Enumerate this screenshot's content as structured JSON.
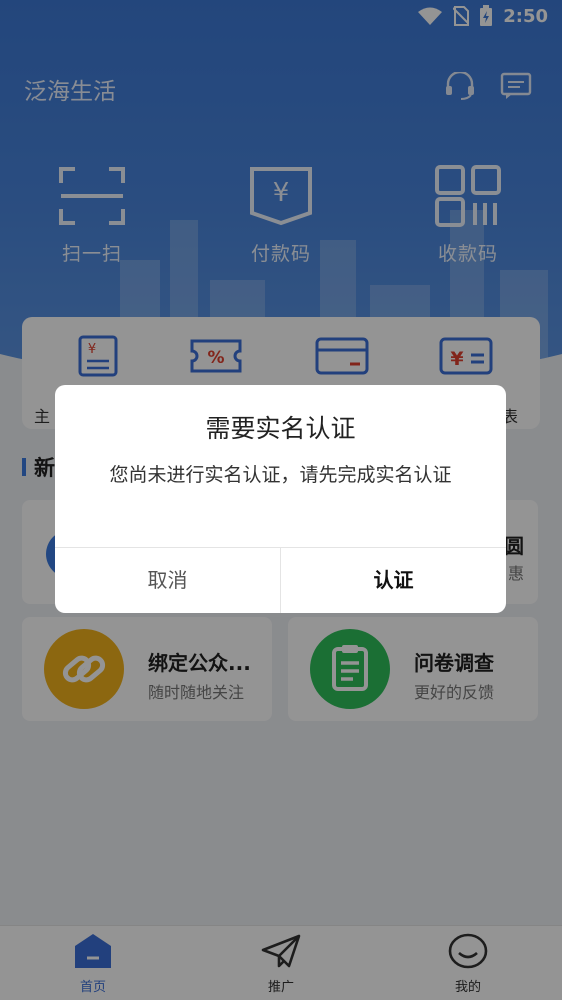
{
  "status_bar": {
    "time": "2:50"
  },
  "header": {
    "app_title": "泛海生活"
  },
  "quick_actions": [
    {
      "label": "扫一扫",
      "icon": "scan-icon"
    },
    {
      "label": "付款码",
      "icon": "payment-code-icon"
    },
    {
      "label": "收款码",
      "icon": "receive-code-icon"
    }
  ],
  "service_card": {
    "items": [
      {
        "icon": "bill-icon",
        "label": "主"
      },
      {
        "icon": "coupon-icon",
        "label": ""
      },
      {
        "icon": "card-icon",
        "label": ""
      },
      {
        "icon": "currency-icon",
        "label": "表"
      }
    ]
  },
  "section": {
    "title": "新"
  },
  "tiles": [
    {
      "title": "",
      "subtitle": "",
      "edge_title": "圆",
      "edge_sub": "惠"
    },
    {
      "title": "绑定公众...",
      "subtitle": "随时随地关注",
      "icon": "link-icon",
      "color": "#f2b21c"
    },
    {
      "title": "问卷调查",
      "subtitle": "更好的反馈",
      "icon": "clipboard-icon",
      "color": "#2fbf5b"
    }
  ],
  "tabbar": {
    "items": [
      {
        "label": "首页",
        "icon": "home-icon"
      },
      {
        "label": "推广",
        "icon": "paper-plane-icon"
      },
      {
        "label": "我的",
        "icon": "smile-icon"
      }
    ]
  },
  "dialog": {
    "title": "需要实名认证",
    "message": "您尚未进行实名认证，请先完成实名认证",
    "cancel_label": "取消",
    "confirm_label": "认证"
  },
  "colors": {
    "brand_blue": "#3d79d6",
    "accent_blue": "#3b7be0"
  }
}
